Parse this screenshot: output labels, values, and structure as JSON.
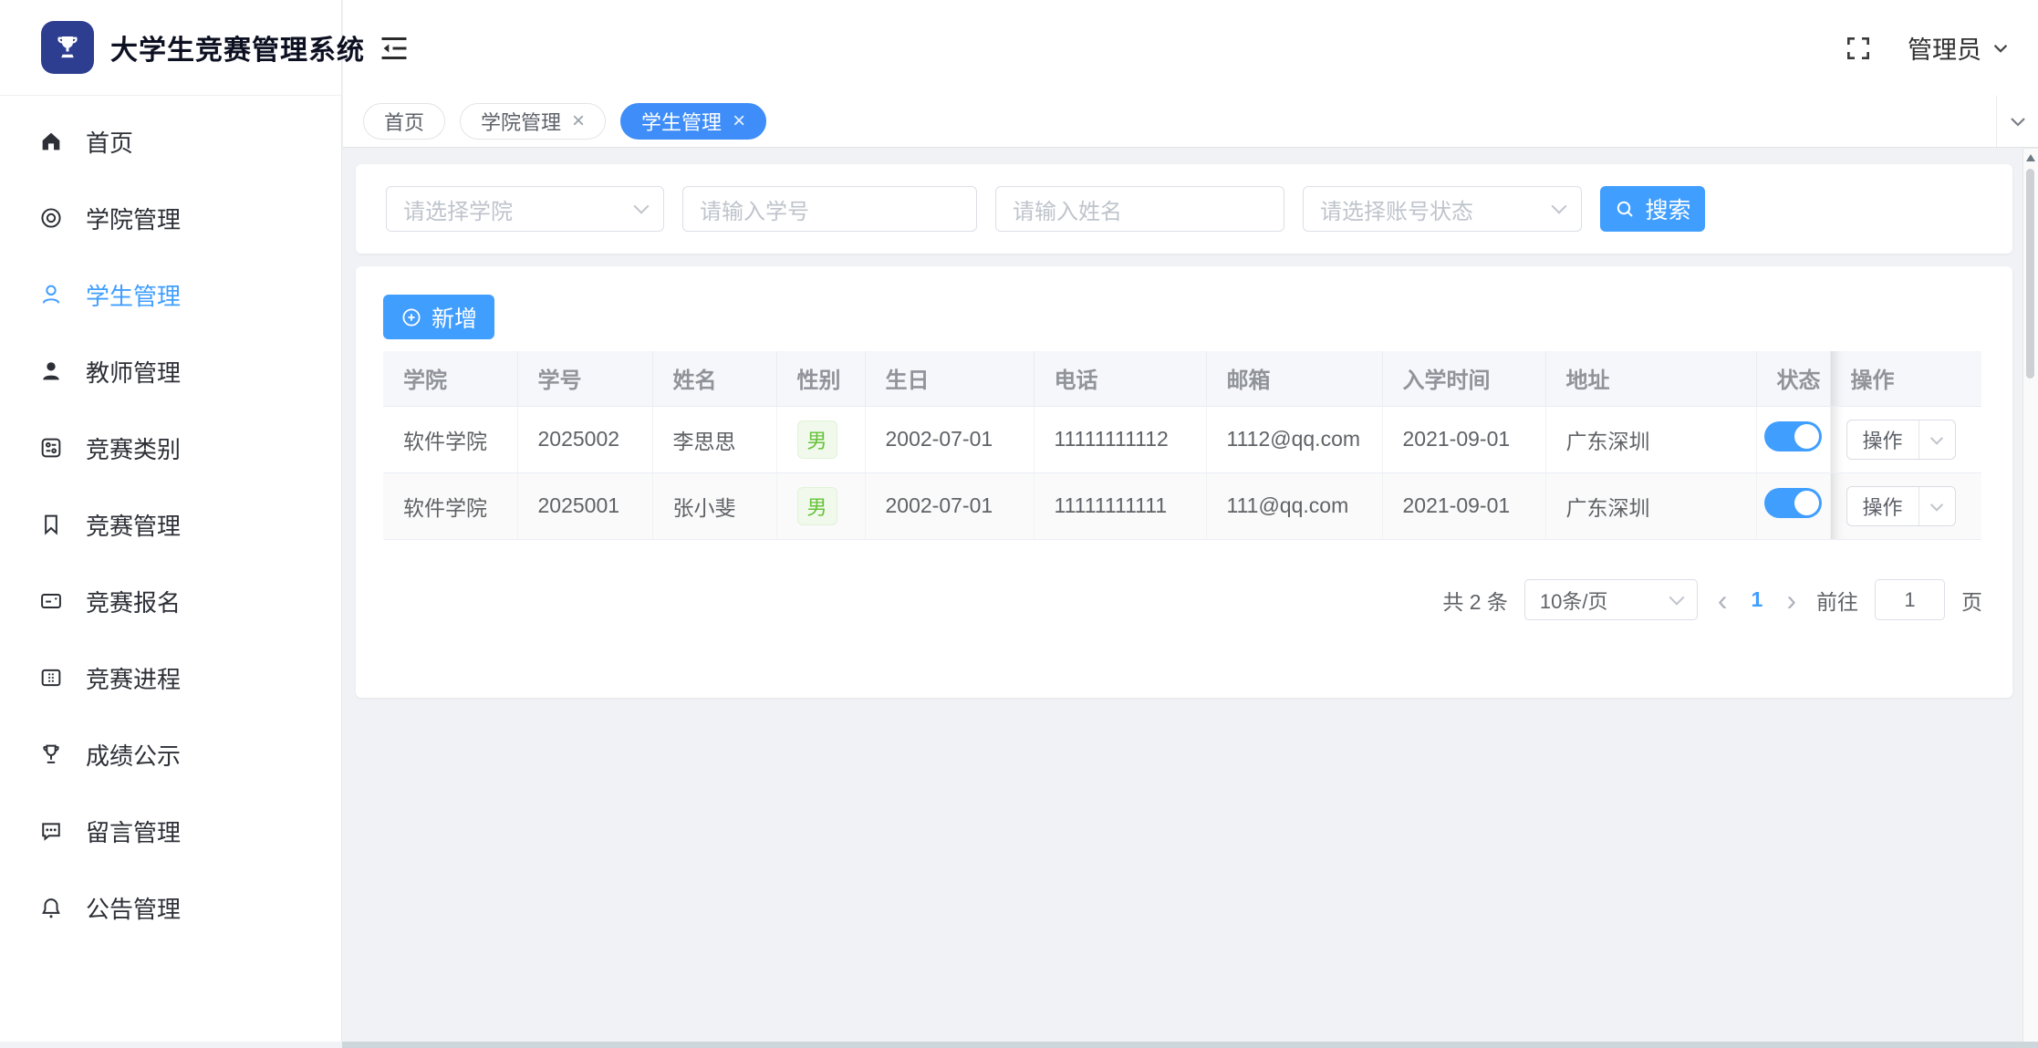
{
  "app": {
    "title": "大学生竞赛管理系统"
  },
  "colors": {
    "primary": "#409eff",
    "active_tab": "#3e8df8",
    "logo_bg": "#2d3e91",
    "tag_text": "#67c23a",
    "tag_bg": "#f0f9eb",
    "page_bg": "#f0f2f5"
  },
  "header": {
    "user": "管理员",
    "icons": [
      "fold-icon",
      "fullscreen-icon",
      "chevron-down-icon"
    ]
  },
  "sidebar": {
    "items": [
      {
        "label": "首页",
        "icon": "home-icon",
        "active": false
      },
      {
        "label": "学院管理",
        "icon": "college-icon",
        "active": false
      },
      {
        "label": "学生管理",
        "icon": "student-icon",
        "active": true
      },
      {
        "label": "教师管理",
        "icon": "teacher-icon",
        "active": false
      },
      {
        "label": "竞赛类别",
        "icon": "category-icon",
        "active": false
      },
      {
        "label": "竞赛管理",
        "icon": "bookmark-icon",
        "active": false
      },
      {
        "label": "竞赛报名",
        "icon": "signup-icon",
        "active": false
      },
      {
        "label": "竞赛进程",
        "icon": "process-icon",
        "active": false
      },
      {
        "label": "成绩公示",
        "icon": "trophy-icon",
        "active": false
      },
      {
        "label": "留言管理",
        "icon": "message-icon",
        "active": false
      },
      {
        "label": "公告管理",
        "icon": "bell-icon",
        "active": false
      }
    ]
  },
  "tabs": [
    {
      "label": "首页",
      "closable": false,
      "active": false
    },
    {
      "label": "学院管理",
      "closable": true,
      "active": false
    },
    {
      "label": "学生管理",
      "closable": true,
      "active": true
    }
  ],
  "search": {
    "college_placeholder": "请选择学院",
    "student_id_placeholder": "请输入学号",
    "name_placeholder": "请输入姓名",
    "status_placeholder": "请选择账号状态",
    "search_label": "搜索"
  },
  "toolbar": {
    "add_label": "新增"
  },
  "table": {
    "columns": [
      "学院",
      "学号",
      "姓名",
      "性别",
      "生日",
      "电话",
      "邮箱",
      "入学时间",
      "地址",
      "状态",
      "操作"
    ],
    "rows": [
      {
        "college": "软件学院",
        "student_id": "2025002",
        "name": "李思思",
        "gender": "男",
        "birthday": "2002-07-01",
        "phone": "11111111112",
        "email": "1112@qq.com",
        "enroll_date": "2021-09-01",
        "address": "广东深圳",
        "status_on": true,
        "action_label": "操作"
      },
      {
        "college": "软件学院",
        "student_id": "2025001",
        "name": "张小斐",
        "gender": "男",
        "birthday": "2002-07-01",
        "phone": "11111111111",
        "email": "111@qq.com",
        "enroll_date": "2021-09-01",
        "address": "广东深圳",
        "status_on": true,
        "action_label": "操作"
      }
    ]
  },
  "pagination": {
    "total_text": "共 2 条",
    "page_size": "10条/页",
    "current_page": "1",
    "goto_label": "前往",
    "goto_value": "1",
    "unit_label": "页"
  }
}
